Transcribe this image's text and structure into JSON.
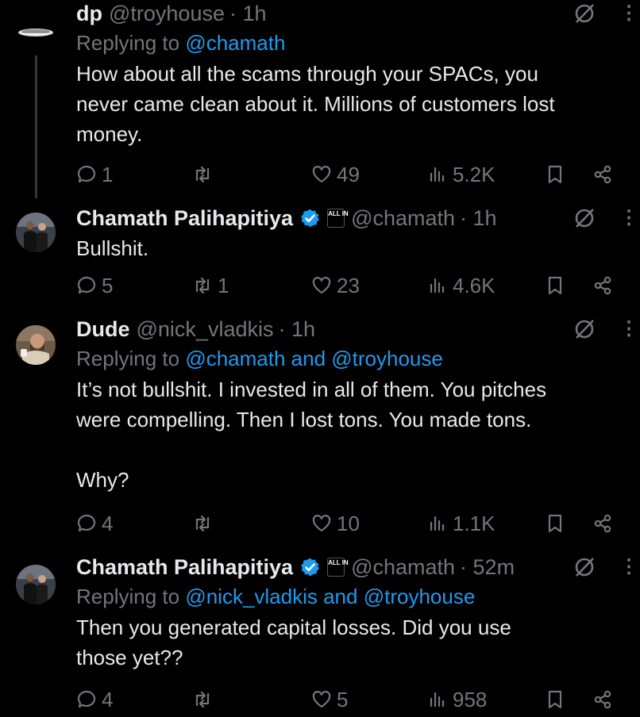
{
  "tweets": [
    {
      "name": "dp",
      "handle": "@troyhouse",
      "time": "· 1h",
      "verified": false,
      "affiliate": false,
      "replying_label": "Replying to",
      "replying_to": "@chamath",
      "lines": [
        "How about all the scams through your SPACs, you",
        "never came clean about it. Millions of customers lost",
        "money."
      ],
      "replies": "1",
      "retweets": "",
      "likes": "49",
      "views": "5.2K"
    },
    {
      "name": "Chamath Palihapitiya",
      "handle": "@chamath",
      "time": "· 1h",
      "verified": true,
      "affiliate": true,
      "replying_label": "",
      "replying_to": "",
      "lines": [
        "Bullshit."
      ],
      "replies": "5",
      "retweets": "1",
      "likes": "23",
      "views": "4.6K"
    },
    {
      "name": "Dude",
      "handle": "@nick_vladkis",
      "time": "· 1h",
      "verified": false,
      "affiliate": false,
      "replying_label": "Replying to",
      "replying_to": "@chamath and @troyhouse",
      "lines": [
        "It’s not bullshit. I invested in all of them. You pitches",
        "were compelling. Then I lost tons. You made tons.",
        "",
        "Why?"
      ],
      "replies": "4",
      "retweets": "",
      "likes": "10",
      "views": "1.1K"
    },
    {
      "name": "Chamath Palihapitiya",
      "handle": "@chamath",
      "time": "· 52m",
      "verified": true,
      "affiliate": true,
      "replying_label": "Replying to",
      "replying_to": "@nick_vladkis and @troyhouse",
      "lines": [
        "Then you generated capital losses. Did you use",
        "those yet??"
      ],
      "replies": "4",
      "retweets": "",
      "likes": "5",
      "views": "958"
    }
  ],
  "affiliate_badge_text": "ALL IN",
  "colors": {
    "background": "#000000",
    "text": "#e7e9ea",
    "muted": "#71767b",
    "link": "#1d9bf0",
    "verified": "#1d9bf0"
  }
}
